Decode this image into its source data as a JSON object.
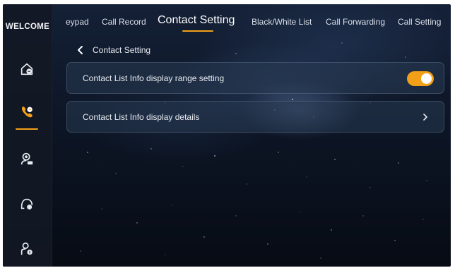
{
  "sidebar": {
    "brand": "WELCOME",
    "items": [
      {
        "icon": "home-shield-icon"
      },
      {
        "icon": "phone-contact-icon",
        "active": true
      },
      {
        "icon": "person-settings-icon"
      },
      {
        "icon": "headset-icon"
      },
      {
        "icon": "user-info-icon"
      }
    ]
  },
  "tabs": [
    {
      "label": "eypad"
    },
    {
      "label": "Call Record"
    },
    {
      "label": "Contact Setting",
      "active": true
    },
    {
      "label": "Black/White List"
    },
    {
      "label": "Call Forwarding"
    },
    {
      "label": "Call Setting"
    }
  ],
  "page": {
    "back_label": "Contact Setting"
  },
  "settings": {
    "range_label": "Contact List Info display range setting",
    "range_enabled": true,
    "details_label": "Contact List Info display details"
  },
  "colors": {
    "accent": "#f3a019",
    "panel": "#283a52",
    "sidebar": "#121824"
  }
}
